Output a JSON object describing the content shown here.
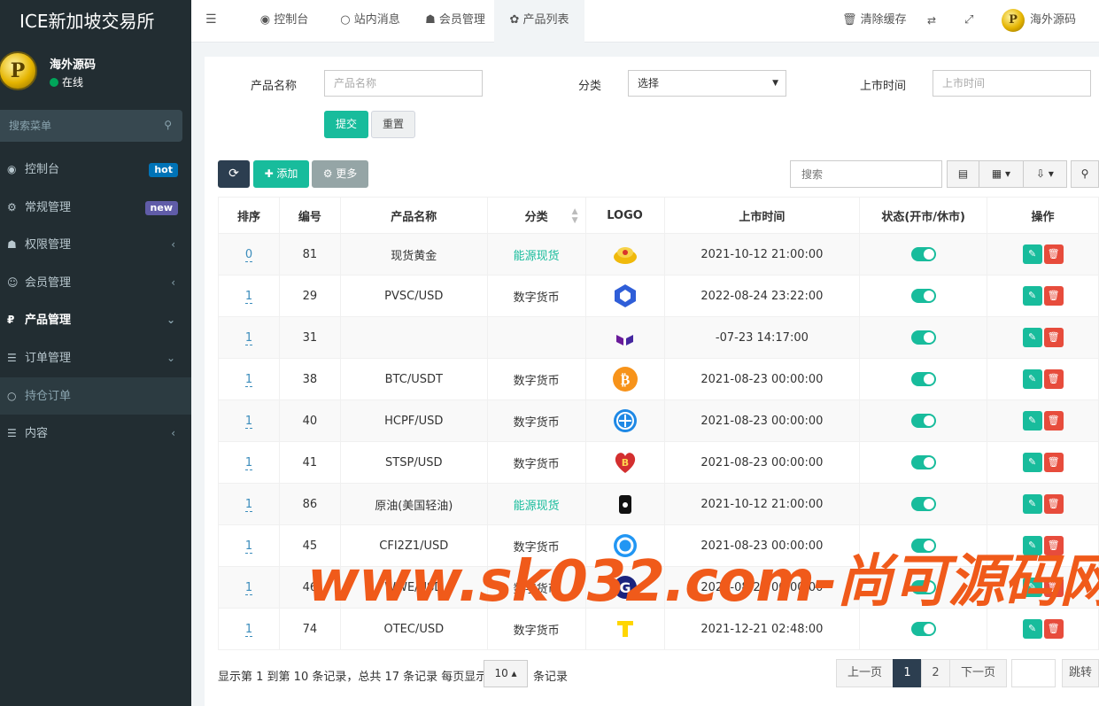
{
  "app": {
    "brand": "ICE新加坡交易所"
  },
  "user": {
    "name": "海外源码",
    "status": "在线",
    "avatar_letter": "P"
  },
  "sidebar": {
    "search_placeholder": "搜索菜单",
    "items": [
      {
        "label": "控制台",
        "icon": "dashboard-icon",
        "glyph": "◉",
        "badge": "hot"
      },
      {
        "label": "常规管理",
        "icon": "cogs-icon",
        "glyph": "⚙",
        "badge": "new"
      },
      {
        "label": "权限管理",
        "icon": "group-icon",
        "glyph": "☗",
        "arrow": "‹"
      },
      {
        "label": "会员管理",
        "icon": "user-icon",
        "glyph": "☺",
        "arrow": "‹"
      },
      {
        "label": "产品管理",
        "icon": "ruble-icon",
        "glyph": "₽",
        "arrow": "⌄"
      },
      {
        "label": "订单管理",
        "icon": "list-icon",
        "glyph": "☰",
        "arrow": "⌄"
      },
      {
        "label": "持仓订单",
        "icon": "circle-icon",
        "glyph": "○"
      },
      {
        "label": "内容",
        "icon": "list-icon",
        "glyph": "☰",
        "arrow": "‹"
      }
    ]
  },
  "topnav": {
    "tabs": [
      {
        "label": "控制台",
        "icon": "◉"
      },
      {
        "label": "站内消息",
        "icon": "○"
      },
      {
        "label": "会员管理",
        "icon": "☗"
      },
      {
        "label": "产品列表",
        "icon": "✿"
      }
    ],
    "clear_cache": "清除缓存",
    "user_name": "海外源码"
  },
  "filter": {
    "name_label": "产品名称",
    "name_placeholder": "产品名称",
    "cat_label": "分类",
    "cat_value": "选择",
    "time_label": "上市时间",
    "time_placeholder": "上市时间",
    "submit": "提交",
    "reset": "重置"
  },
  "toolbar": {
    "add": "✚ 添加",
    "more": "⚙ 更多",
    "search_placeholder": "搜索"
  },
  "table": {
    "headers": [
      "排序",
      "编号",
      "产品名称",
      "分类",
      "LOGO",
      "上市时间",
      "状态(开市/休市)",
      "操作"
    ],
    "rows": [
      {
        "sort": "0",
        "id": "81",
        "name": "现货黄金",
        "cat": "能源现货",
        "cat_green": true,
        "logo": "gold",
        "time": "2021-10-12 21:00:00"
      },
      {
        "sort": "1",
        "id": "29",
        "name": "PVSC/USD",
        "cat": "数字货币",
        "logo": "hex",
        "time": "2022-08-24 23:22:00"
      },
      {
        "sort": "1",
        "id": "31",
        "name": "",
        "cat": "",
        "logo": "purple",
        "time": "-07-23 14:17:00"
      },
      {
        "sort": "1",
        "id": "38",
        "name": "BTC/USDT",
        "cat": "数字货币",
        "logo": "btc",
        "time": "2021-08-23 00:00:00"
      },
      {
        "sort": "1",
        "id": "40",
        "name": "HCPF/USD",
        "cat": "数字货币",
        "logo": "blue",
        "time": "2021-08-23 00:00:00"
      },
      {
        "sort": "1",
        "id": "41",
        "name": "STSP/USD",
        "cat": "数字货币",
        "logo": "heart",
        "time": "2021-08-23 00:00:00"
      },
      {
        "sort": "1",
        "id": "86",
        "name": "原油(美国轻油)",
        "cat": "能源现货",
        "cat_green": true,
        "logo": "oil",
        "time": "2021-10-12 21:00:00"
      },
      {
        "sort": "1",
        "id": "45",
        "name": "CFI2Z1/USD",
        "cat": "数字货币",
        "logo": "cyan",
        "time": "2021-08-23 00:00:00"
      },
      {
        "sort": "1",
        "id": "46",
        "name": "WWE/USD",
        "cat": "数字货币",
        "logo": "g",
        "time": "2021-08-23 00:00:00"
      },
      {
        "sort": "1",
        "id": "74",
        "name": "OTEC/USD",
        "cat": "数字货币",
        "logo": "t",
        "time": "2021-12-21 02:48:00"
      }
    ]
  },
  "pagination": {
    "info": "显示第 1 到第 10 条记录，总共 17 条记录 每页显示",
    "page_size": "10 ▴",
    "info_suffix": "条记录",
    "prev": "上一页",
    "pages": [
      "1",
      "2"
    ],
    "next": "下一页",
    "jump": "跳转"
  },
  "watermark": "www.sk032.com-尚可源码网",
  "colors": {
    "sidebar_bg": "#222d32",
    "accent": "#18bc9c",
    "danger": "#e74c3c",
    "dark": "#2c3e50",
    "watermark": "#f05a1a"
  }
}
